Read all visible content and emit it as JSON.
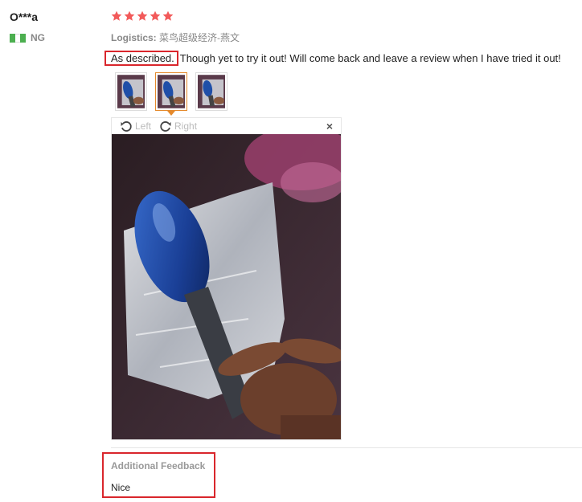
{
  "reviewer": {
    "name": "O***a",
    "country": "NG"
  },
  "rating": {
    "stars": 5,
    "max": 5,
    "color": "#f25a5a"
  },
  "logistics": {
    "label": "Logistics:",
    "value": "菜鸟超级经济-燕文"
  },
  "review": {
    "highlight": "As described.",
    "text": "Though yet to try it out! Will come back and leave a review when I have tried it out!"
  },
  "gallery": {
    "thumbnail_count": 3,
    "active_index": 1,
    "left_label": "Left",
    "right_label": "Right",
    "close_symbol": "×"
  },
  "additional_feedback": {
    "title": "Additional Feedback",
    "text": "Nice"
  },
  "colors": {
    "highlight_border": "#d9262c",
    "active_thumb": "#e58a2c"
  }
}
